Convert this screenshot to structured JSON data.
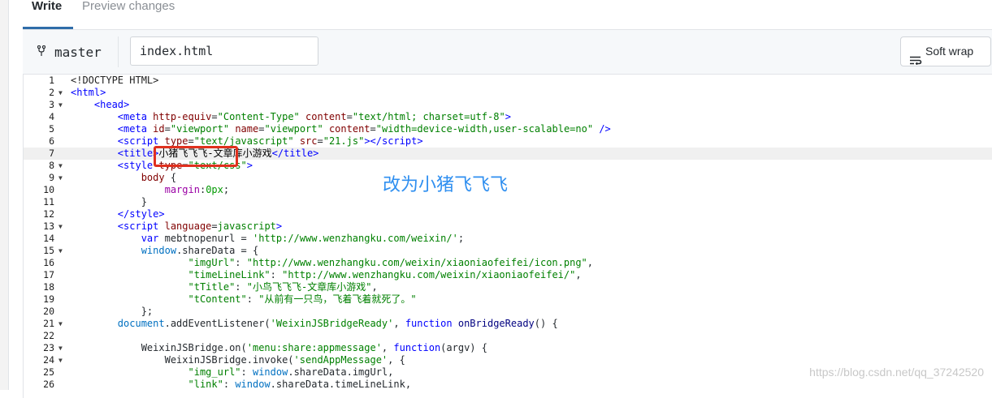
{
  "tabs": [
    {
      "label": "Write",
      "active": true
    },
    {
      "label": "Preview changes",
      "active": false
    }
  ],
  "toolbar": {
    "branch_icon": "branch-icon",
    "branch": "master",
    "filename": "index.html",
    "softwrap_label": "Soft wrap",
    "softwrap_icon": "wrap-icon"
  },
  "code_lines": [
    {
      "n": "1",
      "fold": "",
      "html": "<span class=\"t-plain\">&lt;!DOCTYPE HTML&gt;</span>"
    },
    {
      "n": "2",
      "fold": "▼",
      "html": "<span class=\"t-tag\">&lt;html&gt;</span>"
    },
    {
      "n": "3",
      "fold": "▼",
      "html": "    <span class=\"t-tag\">&lt;head&gt;</span>"
    },
    {
      "n": "4",
      "fold": "",
      "html": "        <span class=\"t-tag\">&lt;meta</span> <span class=\"t-attr\">http-equiv</span>=<span class=\"t-str\">\"Content-Type\"</span> <span class=\"t-attr\">content</span>=<span class=\"t-str\">\"text/html; charset=utf-8\"</span><span class=\"t-tag\">&gt;</span>"
    },
    {
      "n": "5",
      "fold": "",
      "html": "        <span class=\"t-tag\">&lt;meta</span> <span class=\"t-attr\">id</span>=<span class=\"t-str\">\"viewport\"</span> <span class=\"t-attr\">name</span>=<span class=\"t-str\">\"viewport\"</span> <span class=\"t-attr\">content</span>=<span class=\"t-str\">\"width=device-width,user-scalable=no\"</span> <span class=\"t-tag\">/&gt;</span>"
    },
    {
      "n": "6",
      "fold": "",
      "html": "        <span class=\"t-tag\">&lt;script</span> <span class=\"t-attr\">type</span>=<span class=\"t-str\">\"text/javascript\"</span> <span class=\"t-attr\">src</span>=<span class=\"t-str\">\"21.js\"</span><span class=\"t-tag\">&gt;&lt;/script&gt;</span>"
    },
    {
      "n": "7",
      "fold": "",
      "active": true,
      "html": "        <span class=\"t-tag\">&lt;title&gt;</span><span class=\"t-text\">小猪飞飞飞-文章库小游戏</span><span class=\"t-tag\">&lt;/title&gt;</span>"
    },
    {
      "n": "8",
      "fold": "▼",
      "html": "        <span class=\"t-tag\">&lt;style</span> <span class=\"t-attr\">type</span>=<span class=\"t-str\">\"text/css\"</span><span class=\"t-tag\">&gt;</span>"
    },
    {
      "n": "9",
      "fold": "▼",
      "html": "            <span class=\"t-sel\">body</span> {"
    },
    {
      "n": "10",
      "fold": "",
      "html": "                <span class=\"t-prop\">margin</span>:<span class=\"t-num\">0px</span>;"
    },
    {
      "n": "11",
      "fold": "",
      "html": "            }"
    },
    {
      "n": "12",
      "fold": "",
      "html": "        <span class=\"t-tag\">&lt;/style&gt;</span>"
    },
    {
      "n": "13",
      "fold": "▼",
      "html": "        <span class=\"t-tag\">&lt;script</span> <span class=\"t-attr\">language</span>=<span class=\"t-str\">javascript</span><span class=\"t-tag\">&gt;</span>"
    },
    {
      "n": "14",
      "fold": "",
      "html": "            <span class=\"t-kw\">var</span> mebtnopenurl = <span class=\"t-str\">'http://www.wenzhangku.com/weixin/'</span>;"
    },
    {
      "n": "15",
      "fold": "▼",
      "html": "            <span class=\"t-obj\">window</span>.shareData = {"
    },
    {
      "n": "16",
      "fold": "",
      "html": "                    <span class=\"t-str\">\"imgUrl\"</span>: <span class=\"t-str\">\"http://www.wenzhangku.com/weixin/xiaoniaofeifei/icon.png\"</span>,"
    },
    {
      "n": "17",
      "fold": "",
      "html": "                    <span class=\"t-str\">\"timeLineLink\"</span>: <span class=\"t-str\">\"http://www.wenzhangku.com/weixin/xiaoniaofeifei/\"</span>,"
    },
    {
      "n": "18",
      "fold": "",
      "html": "                    <span class=\"t-str\">\"tTitle\"</span>: <span class=\"t-str\">\"小鸟飞飞飞-文章库小游戏\"</span>,"
    },
    {
      "n": "19",
      "fold": "",
      "html": "                    <span class=\"t-str\">\"tContent\"</span>: <span class=\"t-str\">\"从前有一只鸟，飞着飞着就死了。\"</span>"
    },
    {
      "n": "20",
      "fold": "",
      "html": "            };"
    },
    {
      "n": "21",
      "fold": "▼",
      "html": "        <span class=\"t-obj\">document</span>.addEventListener(<span class=\"t-str\">'WeixinJSBridgeReady'</span>, <span class=\"t-kw\">function</span> <span class=\"t-fn\">onBridgeReady</span>() {"
    },
    {
      "n": "22",
      "fold": "",
      "html": ""
    },
    {
      "n": "23",
      "fold": "▼",
      "html": "            WeixinJSBridge.on(<span class=\"t-str\">'menu:share:appmessage'</span>, <span class=\"t-kw\">function</span>(argv) {"
    },
    {
      "n": "24",
      "fold": "▼",
      "html": "                WeixinJSBridge.invoke(<span class=\"t-str\">'sendAppMessage'</span>, {"
    },
    {
      "n": "25",
      "fold": "",
      "html": "                    <span class=\"t-str\">\"img_url\"</span>: <span class=\"t-obj\">window</span>.shareData.imgUrl,"
    },
    {
      "n": "26",
      "fold": "",
      "html": "                    <span class=\"t-str\">\"link\"</span>: <span class=\"t-obj\">window</span>.shareData.timeLineLink,"
    }
  ],
  "annotation": "改为小猪飞飞飞",
  "watermark": "https://blog.csdn.net/qq_37242520",
  "colors": {
    "tab_underline": "#2f6da9",
    "highlight_box": "#e0301e",
    "annotation": "#2f8ff0"
  }
}
